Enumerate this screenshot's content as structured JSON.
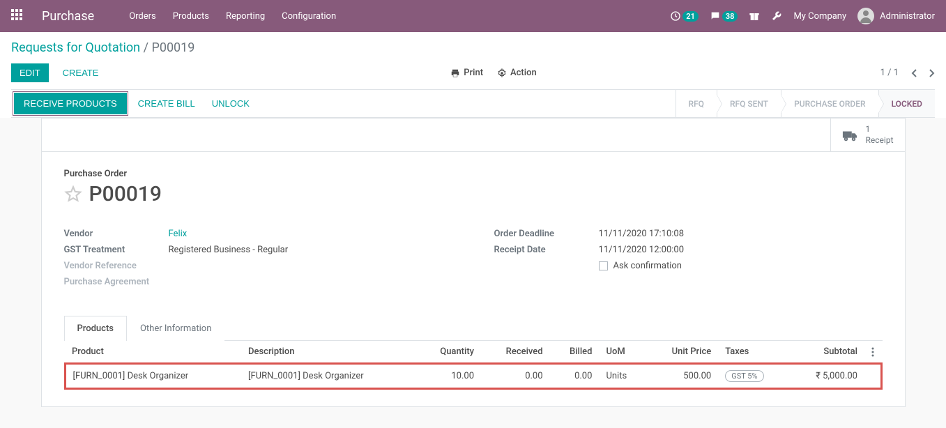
{
  "navbar": {
    "brand": "Purchase",
    "menu": [
      "Orders",
      "Products",
      "Reporting",
      "Configuration"
    ],
    "timer_badge": "21",
    "discuss_badge": "38",
    "company": "My Company",
    "user": "Administrator"
  },
  "breadcrumb": {
    "parent": "Requests for Quotation",
    "current": "P00019"
  },
  "cp": {
    "edit": "EDIT",
    "create": "CREATE",
    "print": "Print",
    "action": "Action",
    "pager": "1 / 1"
  },
  "statusbar": {
    "buttons": [
      "RECEIVE PRODUCTS",
      "CREATE BILL",
      "UNLOCK"
    ],
    "steps": [
      "RFQ",
      "RFQ SENT",
      "PURCHASE ORDER",
      "LOCKED"
    ]
  },
  "stat_button": {
    "count": "1",
    "label": "Receipt"
  },
  "form": {
    "subtitle": "Purchase Order",
    "name": "P00019",
    "left": {
      "vendor_label": "Vendor",
      "vendor": "Felix",
      "gst_label": "GST Treatment",
      "gst": "Registered Business - Regular",
      "ref_label": "Vendor Reference",
      "agreement_label": "Purchase Agreement"
    },
    "right": {
      "deadline_label": "Order Deadline",
      "deadline": "11/11/2020 17:10:08",
      "receipt_label": "Receipt Date",
      "receipt": "11/11/2020 12:00:00",
      "ask_conf": "Ask confirmation"
    }
  },
  "notebook": {
    "tabs": [
      "Products",
      "Other Information"
    ],
    "columns": {
      "product": "Product",
      "description": "Description",
      "quantity": "Quantity",
      "received": "Received",
      "billed": "Billed",
      "uom": "UoM",
      "unit_price": "Unit Price",
      "taxes": "Taxes",
      "subtotal": "Subtotal"
    },
    "line": {
      "product": "[FURN_0001] Desk Organizer",
      "description": "[FURN_0001] Desk Organizer",
      "quantity": "10.00",
      "received": "0.00",
      "billed": "0.00",
      "uom": "Units",
      "unit_price": "500.00",
      "tax": "GST 5%",
      "subtotal": "₹ 5,000.00"
    }
  }
}
